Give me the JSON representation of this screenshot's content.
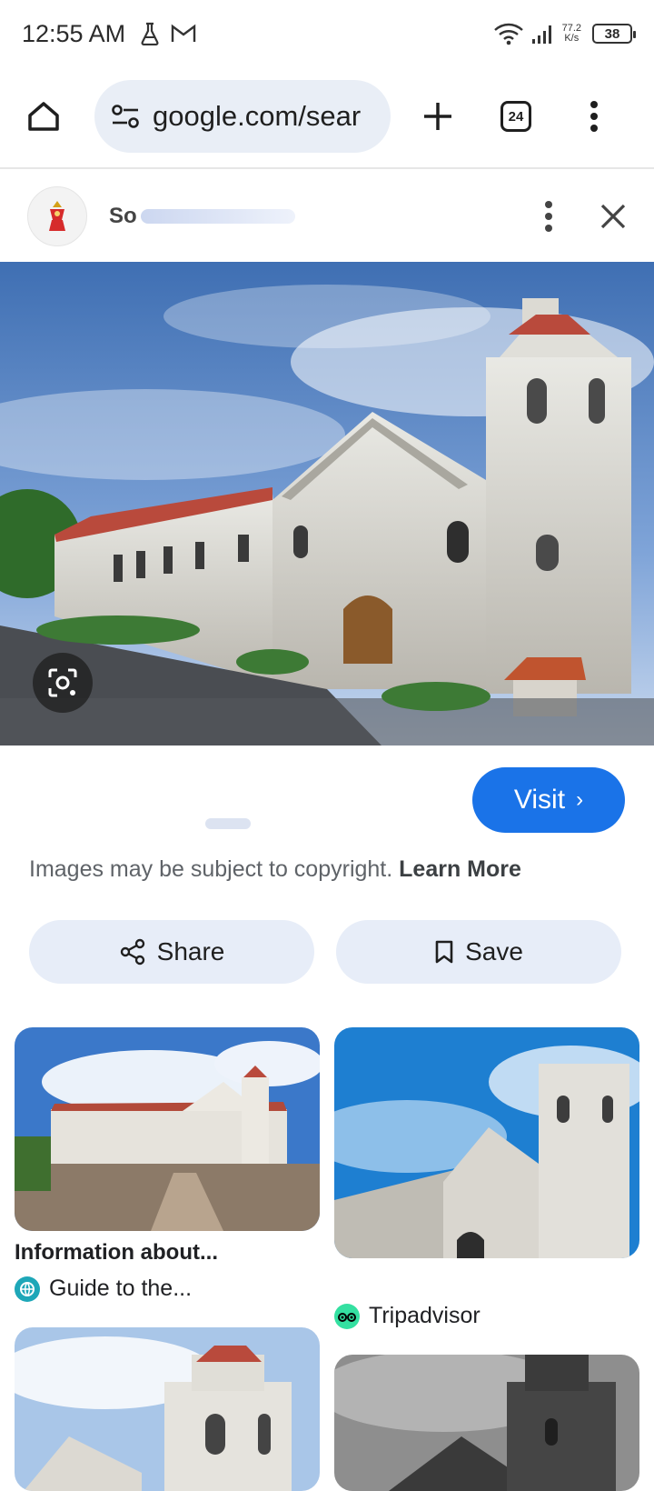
{
  "status_bar": {
    "time": "12:55 AM",
    "net_speed_value": "77.2",
    "net_speed_unit": "K/s",
    "battery": "38"
  },
  "browser": {
    "url": "google.com/sear",
    "tab_count": "24"
  },
  "source": {
    "name": "So"
  },
  "visit_label": "Visit",
  "copyright_text": "Images may be subject to copyright.",
  "learn_more": "Learn More",
  "share_label": "Share",
  "save_label": "Save",
  "results": [
    {
      "title": "Information about...",
      "source": "Guide to the..."
    },
    {
      "title": "",
      "source": "Tripadvisor"
    }
  ],
  "colors": {
    "accent": "#1a73e8",
    "pill_bg": "#e9eef6",
    "button_bg": "#e7edf8"
  },
  "icons": [
    "home-icon",
    "tune-icon",
    "plus-icon",
    "tabs-icon",
    "more-icon",
    "close-icon",
    "lens-icon",
    "share-icon",
    "bookmark-icon"
  ]
}
